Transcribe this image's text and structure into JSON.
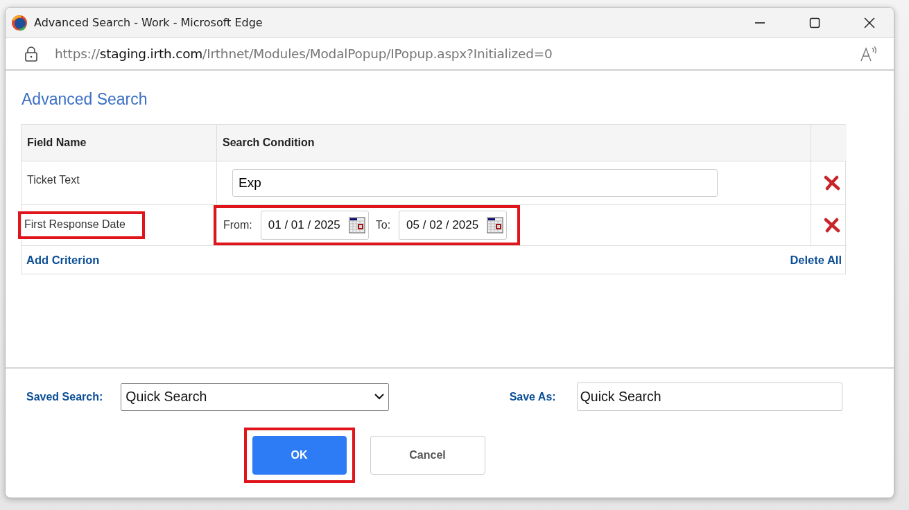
{
  "window": {
    "title": "Advanced Search - Work - Microsoft Edge"
  },
  "address_bar": {
    "scheme": "https://",
    "host": "staging.irth.com",
    "path": "/Irthnet/Modules/ModalPopup/IPopup.aspx?Initialized=0"
  },
  "heading": "Advanced Search",
  "table": {
    "columns": [
      "Field Name",
      "Search Condition"
    ],
    "rows": [
      {
        "kind": "text",
        "field": "Ticket Text",
        "highlighted": false,
        "value": "Exp"
      },
      {
        "kind": "daterange",
        "field": "First Response Date",
        "highlighted": true,
        "from_label": "From:",
        "from": [
          "01",
          "/",
          "01",
          "/",
          "2025"
        ],
        "to_label": "To:",
        "to": [
          "05",
          "/",
          "02",
          "/",
          "2025"
        ]
      }
    ],
    "add_link": "Add Criterion",
    "delete_all_link": "Delete All"
  },
  "saved_search": {
    "label": "Saved Search:",
    "value": "Quick Search"
  },
  "save_as": {
    "label": "Save As:",
    "value": "Quick Search"
  },
  "buttons": [
    {
      "kind": "primary",
      "label": "OK",
      "highlighted": true
    },
    {
      "kind": "secondary",
      "label": "Cancel",
      "highlighted": false
    }
  ]
}
